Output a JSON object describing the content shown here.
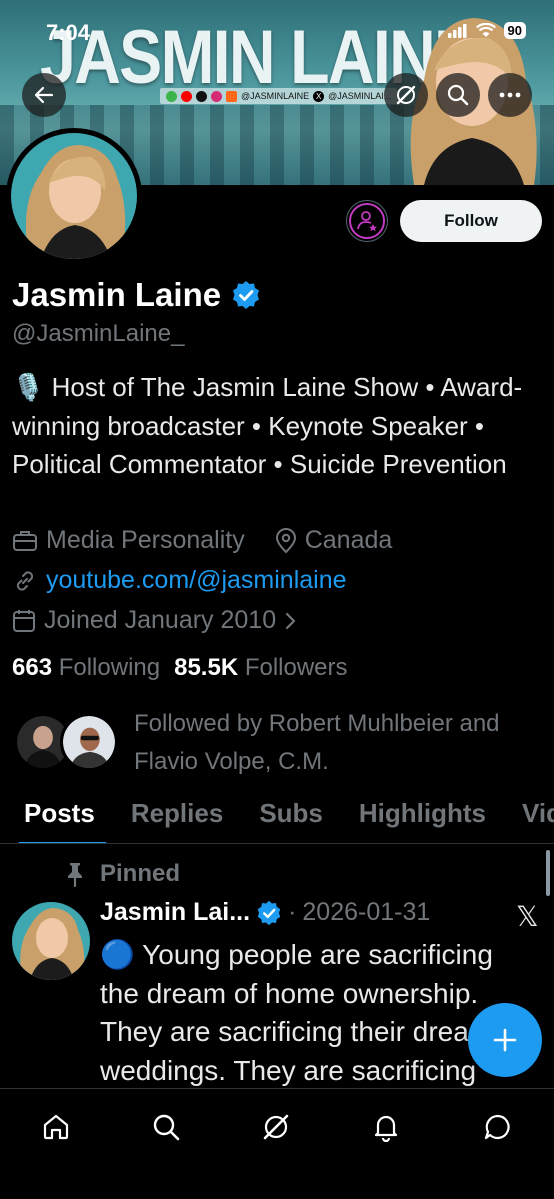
{
  "status_bar": {
    "time": "7:04",
    "battery": "90"
  },
  "banner": {
    "title": "JASMIN LAINE",
    "social_handle_1": "@JASMINLAINE",
    "social_handle_2": "@JASMINLAI..."
  },
  "profile": {
    "name": "Jasmin Laine",
    "handle": "@JasminLaine_",
    "follow_label": "Follow",
    "bio": "🎙️ Host of The Jasmin Laine Show • Award-winning broadcaster • Keynote Speaker • Political Commentator • Suicide Prevention",
    "category": "Media Personality",
    "location": "Canada",
    "website": "youtube.com/@jasminlaine",
    "joined": "Joined January 2010",
    "following_count": "663",
    "following_label": "Following",
    "followers_count": "85.5K",
    "followers_label": "Followers",
    "followed_by": "Followed by Robert Muhlbeier and Flavio Volpe, C.M."
  },
  "tabs": [
    {
      "label": "Posts",
      "active": true
    },
    {
      "label": "Replies"
    },
    {
      "label": "Subs"
    },
    {
      "label": "Highlights"
    },
    {
      "label": "Vide"
    }
  ],
  "pinned_post": {
    "pinned_label": "Pinned",
    "author": "Jasmin Lai...",
    "separator": "·",
    "date": "2026-01-31",
    "text": "🔵 Young people are sacrificing the dream of home ownership. They are sacrificing their dream weddings. They are sacrificing"
  },
  "icons": {
    "back": "back-arrow-icon",
    "grok": "grok-icon",
    "search": "search-icon",
    "more": "more-icon",
    "home": "home-icon",
    "notifications": "bell-icon",
    "messages": "chat-icon",
    "compose": "plus-icon"
  },
  "colors": {
    "accent": "#1d9bf0",
    "background": "#000000",
    "secondary_text": "#71767b",
    "subscribe_ring": "#c13ac0"
  }
}
